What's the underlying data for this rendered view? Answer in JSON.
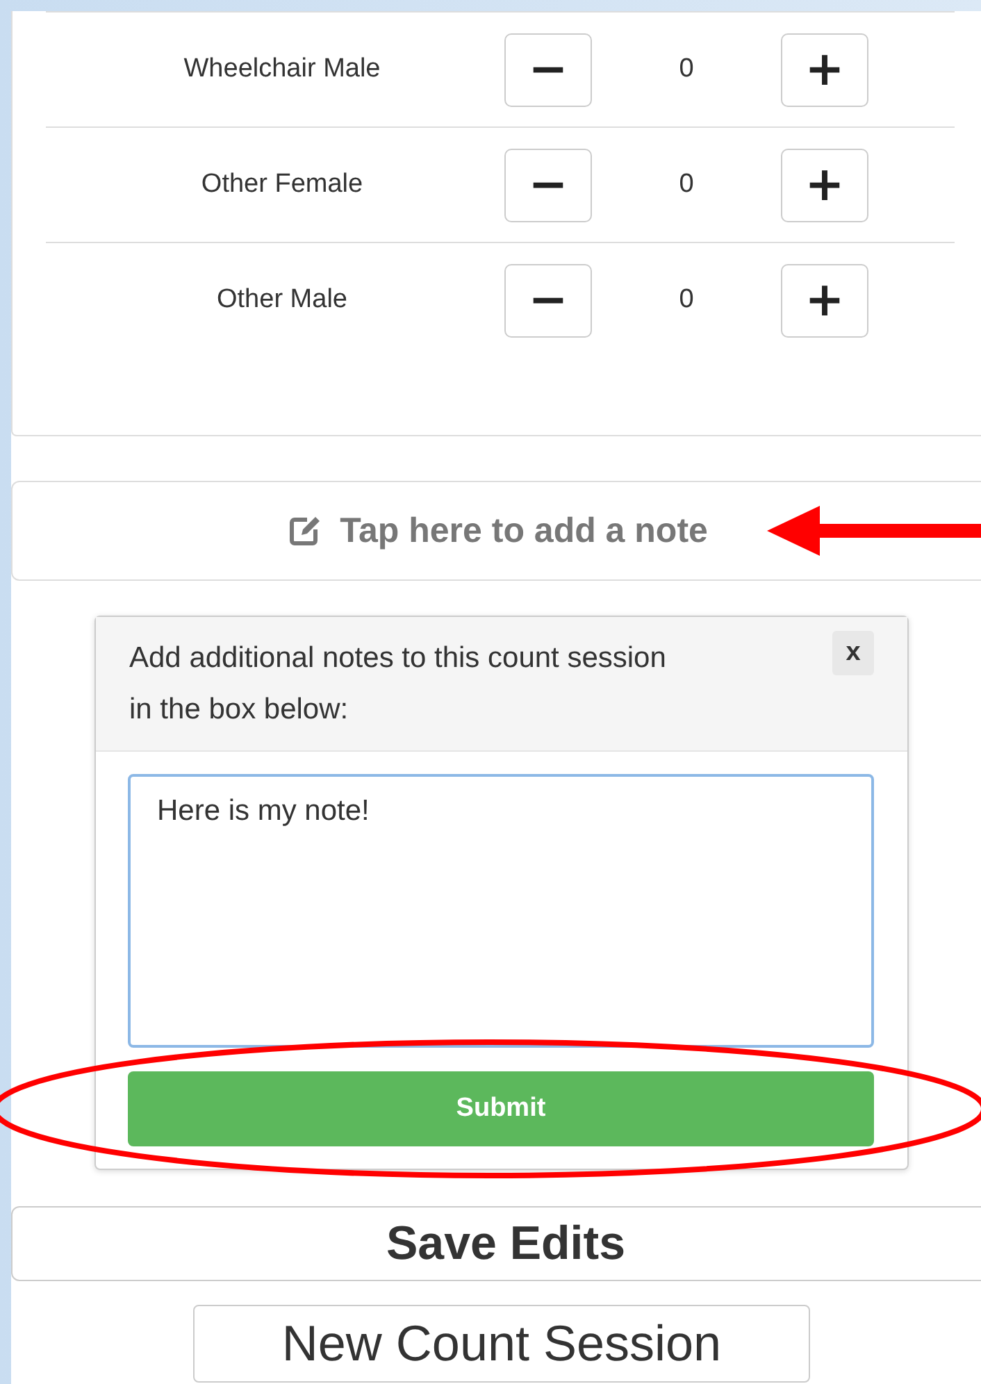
{
  "counters": [
    {
      "label": "Wheelchair Male",
      "decrement": "−",
      "value": "0",
      "increment": "+"
    },
    {
      "label": "Other Female",
      "decrement": "−",
      "value": "0",
      "increment": "+"
    },
    {
      "label": "Other Male",
      "decrement": "−",
      "value": "0",
      "increment": "+"
    }
  ],
  "note_button": {
    "label": "Tap here to add a note"
  },
  "note_panel": {
    "prompt": "Add additional notes to this count session in the box below:",
    "close": "x",
    "note": "Here is my note!",
    "submit": "Submit"
  },
  "save_button": "Save Edits",
  "new_session_button": "New Count Session"
}
